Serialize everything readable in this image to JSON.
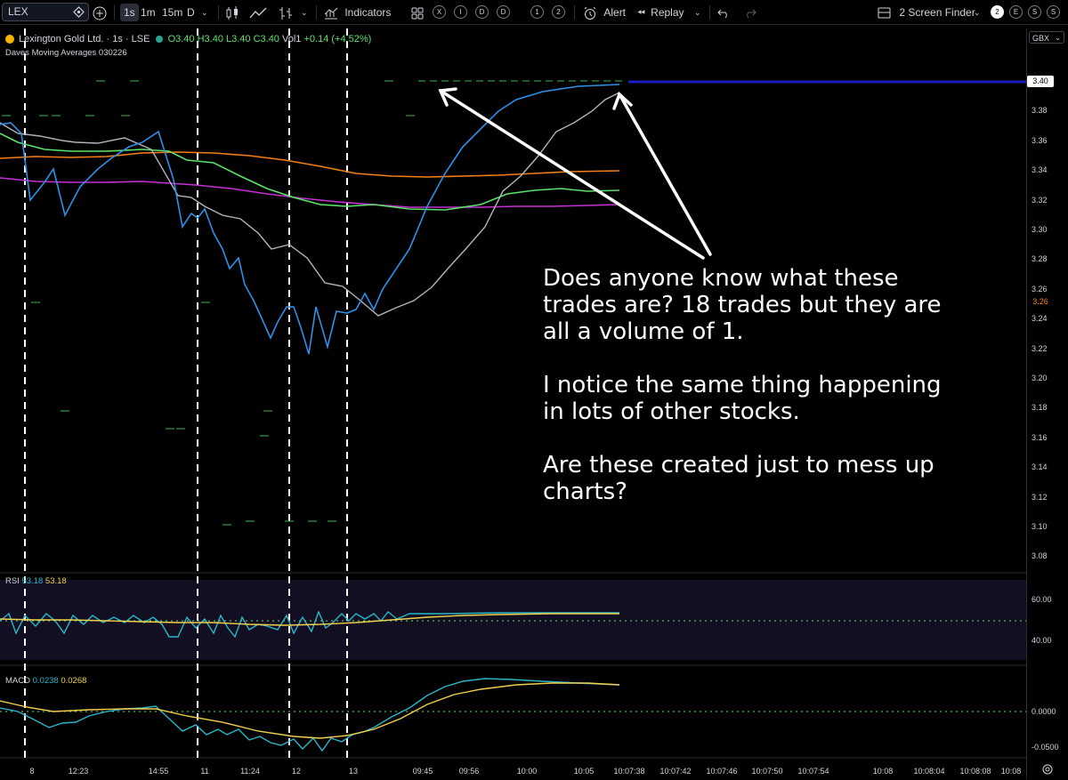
{
  "toolbar": {
    "symbol": "LEX",
    "intervals": [
      "1s",
      "1m",
      "15m",
      "D"
    ],
    "indicators_label": "Indicators",
    "circle_buttons": [
      "X",
      "I",
      "D",
      "D",
      "1",
      "2"
    ],
    "alert_label": "Alert",
    "replay_label": "Replay",
    "screen_finder_label": "2 Screen Finder",
    "right_circles": [
      "2",
      "E",
      "S",
      "S"
    ]
  },
  "legend": {
    "name": "Lexington Gold Ltd. · 1s · LSE",
    "ohlc": "O3.40 H3.40 L3.40 C3.40",
    "vol": "Vol1",
    "change": "+0.14 (+4.52%)",
    "indicator": "Daves Moving Averages 030226"
  },
  "axis": {
    "currency": "GBX",
    "price_ticks": [
      "3.40",
      "3.38",
      "3.36",
      "3.34",
      "3.32",
      "3.30",
      "3.28",
      "3.26",
      "3.24",
      "3.22",
      "3.20",
      "3.18",
      "3.16",
      "3.14",
      "3.12",
      "3.10",
      "3.08"
    ],
    "last_price": "3.40",
    "marker_price": "3.26",
    "rsi_ticks": [
      "60.00",
      "40.00"
    ],
    "macd_ticks": [
      "0.0000",
      "-0.0500"
    ],
    "time_ticks": [
      "8",
      "12:23",
      "14:55",
      "11",
      "11:24",
      "12",
      "13",
      "09:45",
      "09:56",
      "10:00",
      "10:05",
      "10:07:38",
      "10:07:42",
      "10:07:46",
      "10:07:50",
      "10:07:54",
      "10:08",
      "10:08:04",
      "10:08:08",
      "10:08"
    ]
  },
  "rsi": {
    "label": "RSI",
    "value1": "53.18",
    "value2": "53.18"
  },
  "macd": {
    "label": "MACD",
    "value1": "0.0238",
    "value2": "0.0268"
  },
  "annotation": {
    "p1": "Does anyone know what these trades are? 18 trades but they are all a volume of 1.",
    "p2": "I notice the same thing happening in lots of other stocks.",
    "p3": "Are these created just to mess up charts?"
  },
  "colors": {
    "price_line": "#2f8fe8",
    "gray_ma": "#b2b5be",
    "green_ma": "#5de36a",
    "orange_ma": "#f57f17",
    "purple_ma": "#c62fd6",
    "last_price_line": "#1e1ebf",
    "rsi_line": "#29b6c9",
    "signal_line": "#f2d04b"
  }
}
